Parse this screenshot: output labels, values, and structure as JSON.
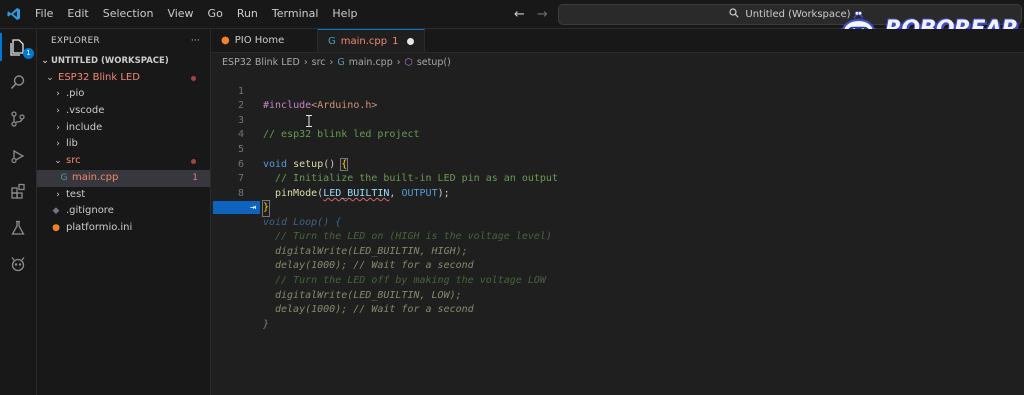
{
  "menu": [
    "File",
    "Edit",
    "Selection",
    "View",
    "Go",
    "Run",
    "Terminal",
    "Help"
  ],
  "command_center": "Untitled (Workspace)",
  "activity_badge": "1",
  "explorer": {
    "title": "EXPLORER",
    "more": "···",
    "workspace": "UNTITLED (WORKSPACE)",
    "project": "ESP32 Blink LED",
    "items": [
      ".pio",
      ".vscode",
      "include",
      "lib",
      "src",
      "main.cpp",
      "test",
      ".gitignore",
      "platformio.ini"
    ],
    "main_count": "1"
  },
  "tabs": [
    {
      "label": "PIO Home"
    },
    {
      "label": "main.cpp",
      "count": "1"
    }
  ],
  "breadcrumb": [
    "ESP32 Blink LED",
    "src",
    "main.cpp",
    "setup()"
  ],
  "line_numbers": [
    "1",
    "2",
    "3",
    "4",
    "5",
    "6",
    "7",
    "8"
  ],
  "code": {
    "l1_inc": "#include",
    "l1_hdr": "<Arduino.h>",
    "l3": "// esp32 blink led project",
    "l5_kw": "void",
    "l5_fn": "setup",
    "l5_rest": "() ",
    "l5_brace": "{",
    "l6": "// Initialize the built-in LED pin as an output",
    "l7_fn": "pinMode",
    "l7_a": "LED_BUILTIN",
    "l7_b": "OUTPUT",
    "l8_brace": "}"
  },
  "ghost": {
    "hint": "⇥",
    "l1": "void Loop() {",
    "l2": "// Turn the LED on (HIGH is the voltage level)",
    "l3": "digitalWrite(LED_BUILTIN, HIGH);",
    "l4": "delay(1000); // Wait for a second",
    "l5": "// Turn the LED off by making the voltage LOW",
    "l6": "digitalWrite(LED_BUILTIN, LOW);",
    "l7": "delay(1000); // Wait for a second",
    "l8": "}"
  },
  "brand": "ROBOREAR",
  "colors": {
    "accent": "#0078d4",
    "modified": "#f48771",
    "brand_outline": "#3d4dc8"
  }
}
